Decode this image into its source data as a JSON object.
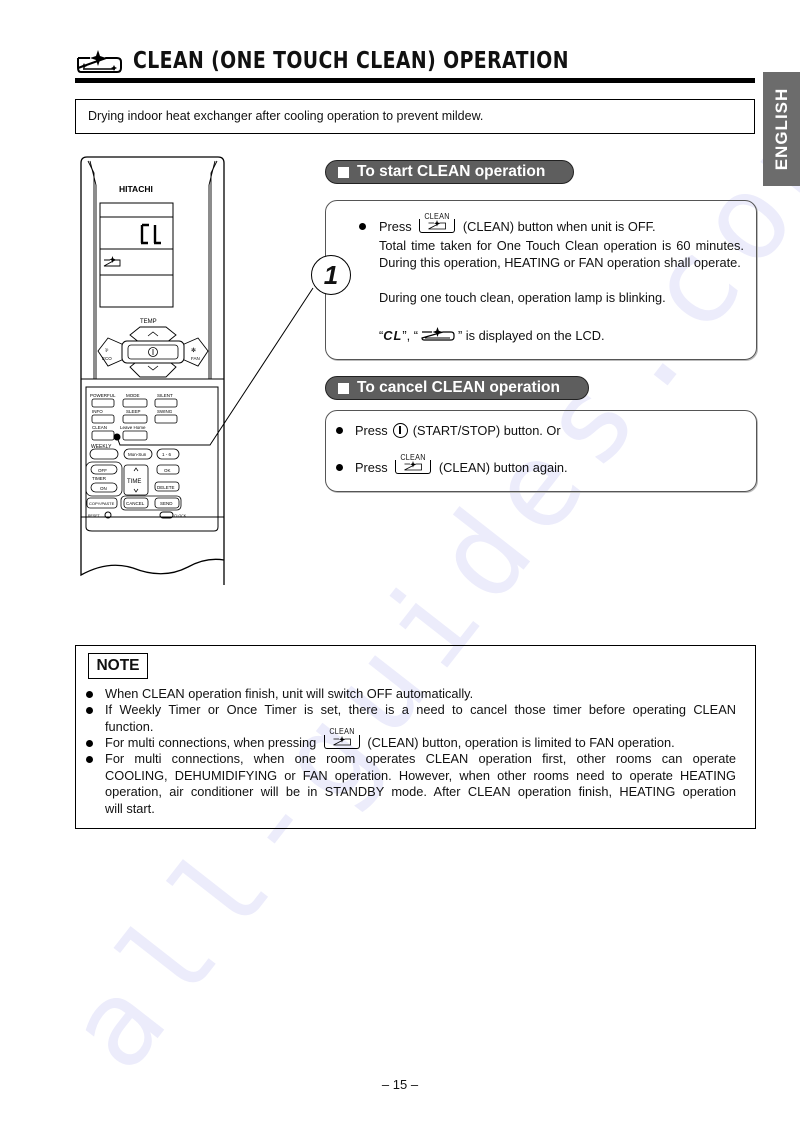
{
  "watermark": "all-guides.com",
  "header": {
    "title": "CLEAN (ONE TOUCH CLEAN) OPERATION",
    "title_icon": "clean-sparkle-icon",
    "language_tab": "ENGLISH"
  },
  "intro": "Drying indoor heat exchanger after cooling operation to prevent mildew.",
  "remote": {
    "brand": "HITACHI",
    "lcd_code": "CL",
    "labels": {
      "temp": "TEMP",
      "eco": "ECO",
      "fan": "FAN",
      "powerful": "POWERFUL",
      "mode": "MODE",
      "silent": "SILENT",
      "info": "INFO",
      "sleep": "SLEEP",
      "swing": "SWING",
      "clean": "CLEAN",
      "leave_home": "Leave Home",
      "weekly": "WEEKLY",
      "mon_sun": "Mon-Sun",
      "one_six": "1 - 6",
      "off": "OFF",
      "timer": "TIMER",
      "on": "ON",
      "time": "TIME",
      "ok": "OK",
      "delete": "DELETE",
      "copy_paste": "COPY/PASTE",
      "cancel": "CANCEL",
      "send": "SEND",
      "reset": "RESET",
      "clock": "CLOCK"
    }
  },
  "start_section": {
    "heading": "To start CLEAN operation",
    "step_number": "1",
    "button_caption": "CLEAN",
    "line1_pre": "Press",
    "line1_post": "(CLEAN) button when unit is OFF.",
    "para1": "Total time taken for One Touch Clean operation is 60 minutes. During this operation, HEATING or FAN operation shall operate.",
    "para2": "During one touch clean, operation lamp is blinking.",
    "lcd_line_open": "“",
    "lcd_line_code": "CL",
    "lcd_line_mid": "”, “",
    "lcd_line_post": "” is displayed on the LCD."
  },
  "cancel_section": {
    "heading": "To cancel CLEAN operation",
    "items": [
      {
        "pre": "Press",
        "icon": "power-icon",
        "post": "(START/STOP) button. Or"
      },
      {
        "pre": "Press",
        "icon": "clean-button-icon",
        "caption": "CLEAN",
        "post": "(CLEAN) button again."
      }
    ]
  },
  "note": {
    "label": "NOTE",
    "items": [
      "When CLEAN operation finish, unit will switch OFF automatically.",
      "If Weekly Timer or Once Timer is set, there is a need to cancel those timer before operating CLEAN",
      "function.",
      "For multi connections, when pressing",
      "(CLEAN) button, operation is limited to FAN operation.",
      "For multi connections, when one room operates CLEAN operation first, other rooms can operate",
      "COOLING, DEHUMIDIFYING or FAN operation. However, when other rooms need to operate HEATING",
      "operation, air conditioner will be in STANDBY mode. After CLEAN operation finish, HEATING operation",
      "will start."
    ],
    "button_caption": "CLEAN"
  },
  "footer": {
    "page_number": "– 15 –"
  }
}
